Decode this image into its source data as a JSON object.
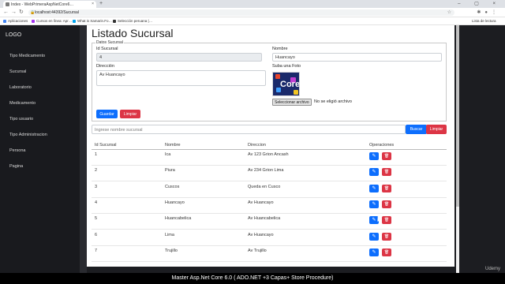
{
  "browser": {
    "tab_title": "Index - WebPrimeraAspNetCore6…",
    "tab_close": "×",
    "new_tab": "+",
    "window_controls": "– ▢ ×",
    "url": "localhost:44392/Sucursal",
    "bookmarks": [
      {
        "label": "Aplicaciones",
        "color": "#4285f4"
      },
      {
        "label": "Cursos en línea: Apr…",
        "color": "#a435f0"
      },
      {
        "label": "What is Xamarin.Fo…",
        "color": "#00a4ef"
      },
      {
        "label": "Selección peruana |…",
        "color": "#333333"
      }
    ],
    "reading_list": "Lista de lectura"
  },
  "sidebar": {
    "logo": "LOGO",
    "items": [
      {
        "label": "Tipo Medicamento"
      },
      {
        "label": "Sucursal"
      },
      {
        "label": "Laboratorio"
      },
      {
        "label": "Medicamento"
      },
      {
        "label": "Tipo usuario"
      },
      {
        "label": "Tipo Administracion"
      },
      {
        "label": "Persona"
      },
      {
        "label": "Pagina"
      }
    ]
  },
  "main": {
    "title": "Listado Sucursal",
    "form": {
      "legend": "Datos Sucursal",
      "id_label": "Id Sucursal",
      "id_value": "4",
      "nombre_label": "Nombre",
      "nombre_value": "Huancayo",
      "direccion_label": "Dirección",
      "direccion_value": "Av Huancayo",
      "foto_label": "Suba una Foto",
      "file_button": "Seleccionar archivo",
      "file_status": "No se eligió archivo",
      "save_label": "Guardar",
      "clear_label": "Limpiar"
    },
    "search": {
      "placeholder": "Ingrese nombre sucursal",
      "search_label": "Buscar",
      "clear_label": "Limpiar"
    },
    "table": {
      "headers": [
        "Id Sucursal",
        "Nombre",
        "Direccion",
        "Operaciones"
      ],
      "rows": [
        {
          "id": "1",
          "nombre": "Ica",
          "direccion": "Av 123 Grion Ancash"
        },
        {
          "id": "2",
          "nombre": "Piura",
          "direccion": "Av 234 Grion Lima"
        },
        {
          "id": "3",
          "nombre": "Cuscos",
          "direccion": "Queda en Cusco"
        },
        {
          "id": "4",
          "nombre": "Huancayo",
          "direccion": "Av Huancayo"
        },
        {
          "id": "5",
          "nombre": "Huancabelica",
          "direccion": "Av Huancabelica"
        },
        {
          "id": "6",
          "nombre": "Lima",
          "direccion": "Av Huancayo"
        },
        {
          "id": "7",
          "nombre": "Trujillo",
          "direccion": "Av Trujillo"
        }
      ],
      "edit_icon": "pencil-icon",
      "delete_icon": "trash-icon"
    }
  },
  "footer": {
    "caption": "Master Asp.Net Core 6.0 ( ADO.NET +3 Capas+ Store Procedure)",
    "watermark": "Udemy"
  }
}
